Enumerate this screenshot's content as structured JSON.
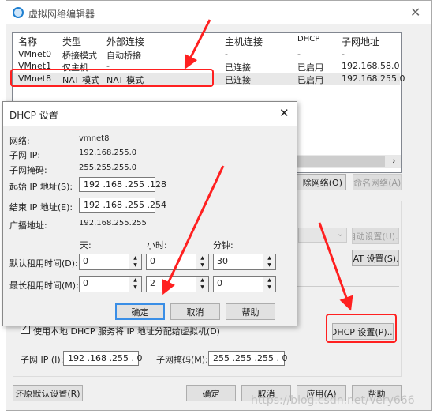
{
  "main_window": {
    "title": "虚拟网络编辑器",
    "columns": [
      "名称",
      "类型",
      "外部连接",
      "主机连接",
      "DHCP",
      "子网地址"
    ],
    "rows": [
      [
        "VMnet0",
        "桥接模式",
        "自动桥接",
        "-",
        "-",
        "-"
      ],
      [
        "VMnet1",
        "仅主机",
        "-",
        "已连接",
        "已启用",
        "192.168.58.0"
      ],
      [
        "VMnet8",
        "NAT 模式",
        "NAT 模式",
        "已连接",
        "已启用",
        "192.168.255.0"
      ]
    ],
    "selected_row": "VMnet8",
    "remove_network": "除网络(O)",
    "rename_network": "重命名网络(A)...",
    "auto_settings": "自动设置(U)...",
    "nat_settings": "NAT 设置(S)...",
    "use_dhcp_label": "使用本地 DHCP 服务将 IP 地址分配给虚拟机(D)",
    "use_dhcp_checked": true,
    "dhcp_settings": "DHCP 设置(P)...",
    "subnet_ip_label": "子网 IP (I):",
    "subnet_ip": "192 .168 .255 .  0",
    "subnet_mask_label": "子网掩码(M):",
    "subnet_mask": "255 .255 .255 .  0",
    "restore_defaults": "还原默认设置(R)",
    "ok": "确定",
    "cancel": "取消",
    "apply": "应用(A)",
    "help": "帮助"
  },
  "dhcp_dialog": {
    "title": "DHCP 设置",
    "network_label": "网络:",
    "network": "vmnet8",
    "subnet_ip_label": "子网 IP:",
    "subnet_ip": "192.168.255.0",
    "subnet_mask_label": "子网掩码:",
    "subnet_mask": "255.255.255.0",
    "start_ip_label": "起始 IP 地址(S):",
    "start_ip": "192 .168 .255 .128",
    "end_ip_label": "结束 IP 地址(E):",
    "end_ip": "192 .168 .255 .254",
    "broadcast_label": "广播地址:",
    "broadcast": "192.168.255.255",
    "days_label": "天:",
    "hours_label": "小时:",
    "minutes_label": "分钟:",
    "default_lease_label": "默认租用时间(D):",
    "default_lease": [
      "0",
      "0",
      "30"
    ],
    "max_lease_label": "最长租用时间(M):",
    "max_lease": [
      "0",
      "2",
      "0"
    ],
    "ok": "确定",
    "cancel": "取消",
    "help": "帮助"
  },
  "watermark": "https://blog.csdn.net/Very666",
  "colors": {
    "annotation": "#ff2020",
    "focus": "#3a8ee6"
  }
}
